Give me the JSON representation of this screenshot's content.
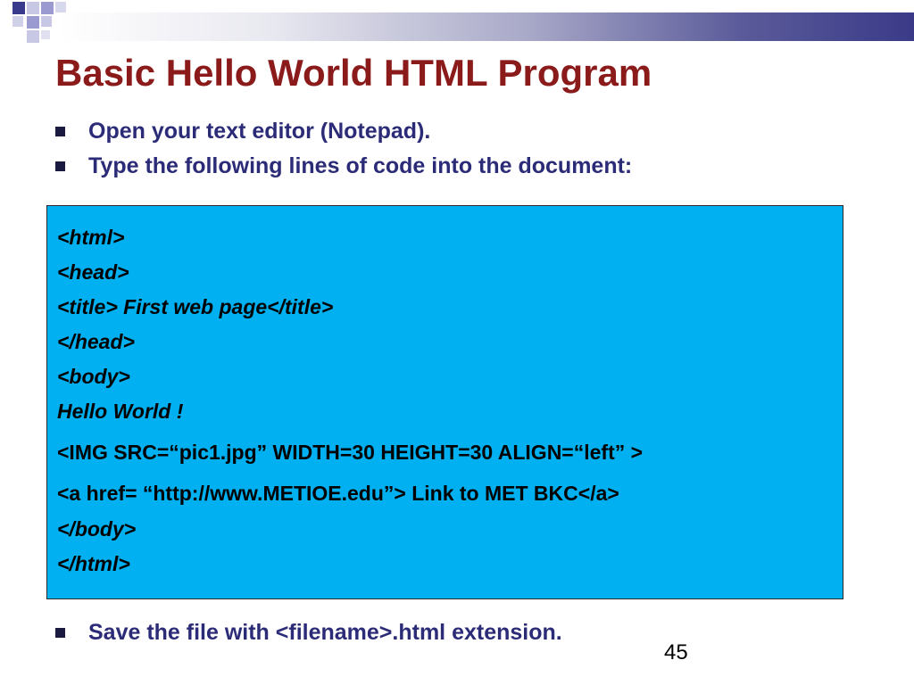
{
  "colors": {
    "title": "#8b1a1a",
    "bullet_text": "#2b2b78",
    "code_bg": "#00b0f0",
    "deco_dark": "#3a3a8c",
    "deco_light": "#9a9ad0"
  },
  "slide": {
    "title": "Basic Hello World HTML Program",
    "bullets": [
      "Open your text editor (Notepad).",
      "Type the following lines of code into the document:"
    ],
    "code_lines": [
      "<html>",
      "<head>",
      "<title> First web page</title>",
      "</head>",
      "<body>",
      "Hello World !",
      "<IMG SRC=“pic1.jpg” WIDTH=30   HEIGHT=30  ALIGN=“left” >",
      "<a href= “http://www.METIOE.edu”> Link to MET BKC</a>",
      "</body>",
      "</html>"
    ],
    "bottom_bullet": "Save the file with <filename>.html extension.",
    "page_number": "45"
  }
}
